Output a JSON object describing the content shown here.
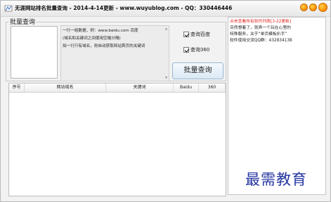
{
  "window": {
    "title": "无涯网站排名批量查询 - 2014-4-14更新 - www.wuyublog.com - QQ：330446446",
    "brand_color": "#ff8a00"
  },
  "query_group": {
    "label": "批量查询",
    "help_lines": [
      "一行一组数据，例：www.baidu.com 百度",
      "(域名和关键词之间使用空格分隔)",
      "如一行只有域名，则自动获取网站首页的关键词"
    ],
    "checkbox_baidu": "查询百度",
    "checkbox_360": "查询360",
    "button_label": "批量查询"
  },
  "table": {
    "columns": [
      "序号",
      "网站域名",
      "关键词",
      "Baidu",
      "360"
    ]
  },
  "side_panel": {
    "link": "点击查看所有软件列表[3-22更新]",
    "lines": [
      "突然想着了，就弄一个玩在心里的",
      "特殊服务，关于“单页模板扒手”",
      "软件使用交流QQ群：432834138"
    ]
  },
  "watermark": "最需教育"
}
